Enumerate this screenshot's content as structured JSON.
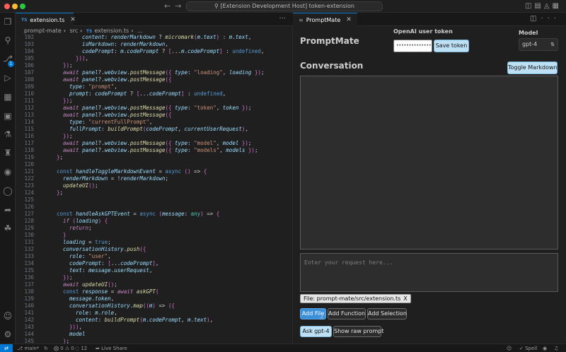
{
  "window": {
    "title": "[Extension Development Host] token-extension",
    "traffic_colors": [
      "#ff5f57",
      "#febc2e",
      "#28c840"
    ]
  },
  "editor": {
    "tab_badge": "TS",
    "tab_label": "extension.ts",
    "breadcrumb": [
      "prompt-mate",
      "src",
      "extension.ts",
      "..."
    ],
    "lines": [
      {
        "n": "102",
        "text": "content: renderMarkdown ? micromark(m.text) : m.text,",
        "indent": 5
      },
      {
        "n": "103",
        "text": "isMarkdown: renderMarkdown,",
        "indent": 5
      },
      {
        "n": "104",
        "text": "codePrompt: m.codePrompt ? [...m.codePrompt] : undefined,",
        "indent": 5
      },
      {
        "n": "105",
        "text": "})),",
        "indent": 4
      },
      {
        "n": "106",
        "text": "});",
        "indent": 2
      },
      {
        "n": "107",
        "text": "await panel?.webview.postMessage({ type: \"loading\", loading });",
        "indent": 2
      },
      {
        "n": "108",
        "text": "await panel?.webview.postMessage({",
        "indent": 2
      },
      {
        "n": "109",
        "text": "type: \"prompt\",",
        "indent": 3
      },
      {
        "n": "110",
        "text": "prompt: codePrompt ? [...codePrompt] : undefined,",
        "indent": 3
      },
      {
        "n": "111",
        "text": "});",
        "indent": 2
      },
      {
        "n": "112",
        "text": "await panel?.webview.postMessage({ type: \"token\", token });",
        "indent": 2
      },
      {
        "n": "113",
        "text": "await panel?.webview.postMessage({",
        "indent": 2
      },
      {
        "n": "114",
        "text": "type: \"currentFullPrompt\",",
        "indent": 3
      },
      {
        "n": "115",
        "text": "fullPrompt: buildPrompt(codePrompt, currentUserRequest),",
        "indent": 3
      },
      {
        "n": "116",
        "text": "});",
        "indent": 2
      },
      {
        "n": "117",
        "text": "await panel?.webview.postMessage({ type: \"model\", model });",
        "indent": 2
      },
      {
        "n": "118",
        "text": "await panel?.webview.postMessage({ type: \"models\", models });",
        "indent": 2
      },
      {
        "n": "119",
        "text": "};",
        "indent": 1
      },
      {
        "n": "120",
        "text": "",
        "indent": 0
      },
      {
        "n": "121",
        "text": "const handleToggleMarkdownEvent = async () => {",
        "indent": 1
      },
      {
        "n": "122",
        "text": "renderMarkdown = !renderMarkdown;",
        "indent": 2
      },
      {
        "n": "123",
        "text": "updateUI();",
        "indent": 2
      },
      {
        "n": "124",
        "text": "};",
        "indent": 1
      },
      {
        "n": "125",
        "text": "",
        "indent": 0
      },
      {
        "n": "126",
        "text": "",
        "indent": 0
      },
      {
        "n": "127",
        "text": "const handleAskGPTEvent = async (message: any) => {",
        "indent": 1
      },
      {
        "n": "128",
        "text": "if (loading) {",
        "indent": 2
      },
      {
        "n": "129",
        "text": "return;",
        "indent": 3
      },
      {
        "n": "130",
        "text": "}",
        "indent": 2
      },
      {
        "n": "131",
        "text": "loading = true;",
        "indent": 2
      },
      {
        "n": "132",
        "text": "conversationHistory.push({",
        "indent": 2
      },
      {
        "n": "133",
        "text": "role: \"user\",",
        "indent": 3
      },
      {
        "n": "134",
        "text": "codePrompt: [...codePrompt],",
        "indent": 3
      },
      {
        "n": "135",
        "text": "text: message.userRequest,",
        "indent": 3
      },
      {
        "n": "136",
        "text": "});",
        "indent": 2
      },
      {
        "n": "137",
        "text": "await updateUI();",
        "indent": 2
      },
      {
        "n": "138",
        "text": "const response = await askGPT(",
        "indent": 2
      },
      {
        "n": "139",
        "text": "message.token,",
        "indent": 3
      },
      {
        "n": "140",
        "text": "conversationHistory.map((m) => ({",
        "indent": 3
      },
      {
        "n": "141",
        "text": "role: m.role,",
        "indent": 4
      },
      {
        "n": "142",
        "text": "content: buildPrompt(m.codePrompt, m.text),",
        "indent": 4
      },
      {
        "n": "143",
        "text": "})),",
        "indent": 3
      },
      {
        "n": "144",
        "text": "model",
        "indent": 3
      },
      {
        "n": "145",
        "text": ");",
        "indent": 2
      }
    ]
  },
  "panel": {
    "tab_label": "PromptMate",
    "app_title": "PromptMate",
    "token_label": "OpenAI user token",
    "token_value": "••••••••••••••••••",
    "save_token_label": "Save token",
    "model_label": "Model",
    "model_value": "gpt-4",
    "conversation_title": "Conversation",
    "toggle_markdown_label": "Toggle Markdown",
    "request_placeholder": "Enter your request here...",
    "file_chip_label": "File: prompt-mate/src/extension.ts",
    "file_chip_close": "X",
    "add_file_label": "Add File",
    "add_function_label": "Add Function",
    "add_selection_label": "Add Selection",
    "ask_gpt_label": "Ask gpt-4",
    "show_raw_label": "Show raw prompt"
  },
  "statusbar": {
    "branch": "main*",
    "problems": "0 ⚠ 0",
    "ports": "12",
    "live_share": "Live Share",
    "spell": "Spell"
  },
  "activity_badge": "1"
}
